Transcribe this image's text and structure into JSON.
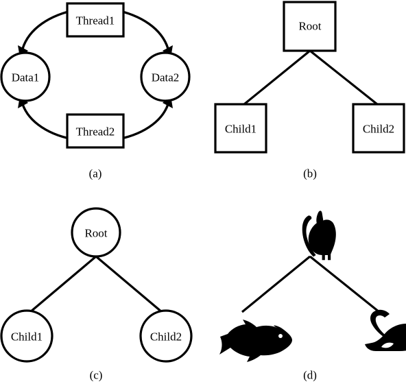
{
  "figure": {
    "title": "Four diagram variants: cyclic thread-data graph and three binary tree renderings",
    "background_color": "#ffffff",
    "stroke_color": "#000000",
    "panel_count": 4
  },
  "panels": [
    {
      "id": "a",
      "caption": "(a)",
      "kind": "cyclic-graph",
      "node_shape_primary": "rectangle",
      "node_shape_secondary": "circle",
      "nodes": [
        {
          "id": "thread1",
          "label": "Thread1",
          "shape": "rectangle",
          "position": "top"
        },
        {
          "id": "data1",
          "label": "Data1",
          "shape": "circle",
          "position": "left"
        },
        {
          "id": "data2",
          "label": "Data2",
          "shape": "circle",
          "position": "right"
        },
        {
          "id": "thread2",
          "label": "Thread2",
          "shape": "rectangle",
          "position": "bottom"
        }
      ],
      "edges": [
        {
          "from": "thread1",
          "to": "data1",
          "style": "curved",
          "arrow": true
        },
        {
          "from": "thread1",
          "to": "data2",
          "style": "curved",
          "arrow": true
        },
        {
          "from": "thread2",
          "to": "data1",
          "style": "curved",
          "arrow": true
        },
        {
          "from": "thread2",
          "to": "data2",
          "style": "curved",
          "arrow": true
        }
      ]
    },
    {
      "id": "b",
      "caption": "(b)",
      "kind": "tree",
      "node_shape_primary": "rectangle",
      "nodes": [
        {
          "id": "root",
          "label": "Root",
          "shape": "rectangle",
          "position": "top"
        },
        {
          "id": "child1",
          "label": "Child1",
          "shape": "rectangle",
          "position": "bottom-left"
        },
        {
          "id": "child2",
          "label": "Child2",
          "shape": "rectangle",
          "position": "bottom-right"
        }
      ],
      "edges": [
        {
          "from": "root",
          "to": "child1",
          "style": "straight",
          "arrow": false
        },
        {
          "from": "root",
          "to": "child2",
          "style": "straight",
          "arrow": false
        }
      ]
    },
    {
      "id": "c",
      "caption": "(c)",
      "kind": "tree",
      "node_shape_primary": "circle",
      "nodes": [
        {
          "id": "root",
          "label": "Root",
          "shape": "circle",
          "position": "top"
        },
        {
          "id": "child1",
          "label": "Child1",
          "shape": "circle",
          "position": "bottom-left"
        },
        {
          "id": "child2",
          "label": "Child2",
          "shape": "circle",
          "position": "bottom-right"
        }
      ],
      "edges": [
        {
          "from": "root",
          "to": "child1",
          "style": "straight",
          "arrow": false
        },
        {
          "from": "root",
          "to": "child2",
          "style": "straight",
          "arrow": false
        }
      ]
    },
    {
      "id": "d",
      "caption": "(d)",
      "kind": "tree",
      "node_shape_primary": "silhouette-icon",
      "nodes": [
        {
          "id": "root",
          "label": "",
          "shape": "cat-silhouette",
          "icon": "cat-icon",
          "position": "top"
        },
        {
          "id": "child1",
          "label": "",
          "shape": "fish-silhouette",
          "icon": "fish-icon",
          "position": "bottom-left"
        },
        {
          "id": "child2",
          "label": "",
          "shape": "mouse-silhouette",
          "icon": "mouse-icon",
          "position": "bottom-right"
        }
      ],
      "edges": [
        {
          "from": "root",
          "to": "child1",
          "style": "straight",
          "arrow": false
        },
        {
          "from": "root",
          "to": "child2",
          "style": "straight",
          "arrow": false
        }
      ]
    }
  ],
  "labels": {
    "thread1": "Thread1",
    "thread2": "Thread2",
    "data1": "Data1",
    "data2": "Data2",
    "root": "Root",
    "child1": "Child1",
    "child2": "Child2"
  },
  "captions": {
    "a": "(a)",
    "b": "(b)",
    "c": "(c)",
    "d": "(d)"
  }
}
